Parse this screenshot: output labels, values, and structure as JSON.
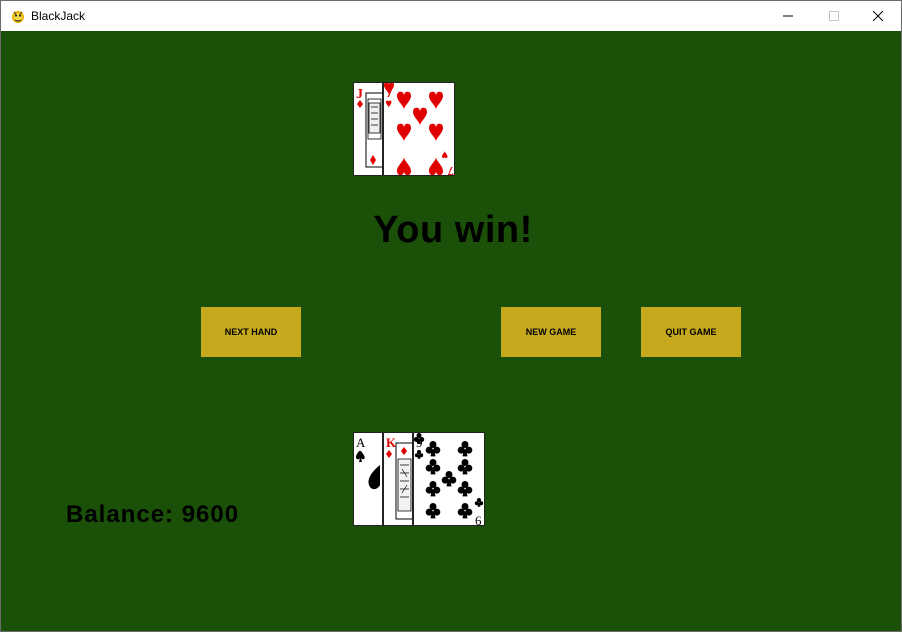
{
  "window": {
    "title": "BlackJack",
    "app_icon": "pygame-snake-icon"
  },
  "status_text": "You win!",
  "buttons": {
    "next_hand": "NEXT HAND",
    "new_game": "NEW GAME",
    "quit_game": "QUIT GAME"
  },
  "balance_text": "Balance: 9600",
  "dealer_hand": [
    {
      "rank": "J",
      "suit": "diamonds",
      "color": "#e00000"
    },
    {
      "rank": "7",
      "suit": "hearts",
      "color": "#e00000"
    }
  ],
  "player_hand": [
    {
      "rank": "A",
      "suit": "spades",
      "color": "#000000"
    },
    {
      "rank": "K",
      "suit": "diamonds",
      "color": "#e00000"
    },
    {
      "rank": "9",
      "suit": "clubs",
      "color": "#000000"
    }
  ],
  "colors": {
    "felt": "#1a5008",
    "button": "#c7a91d",
    "red_suit": "#e00000",
    "black_suit": "#000000"
  }
}
